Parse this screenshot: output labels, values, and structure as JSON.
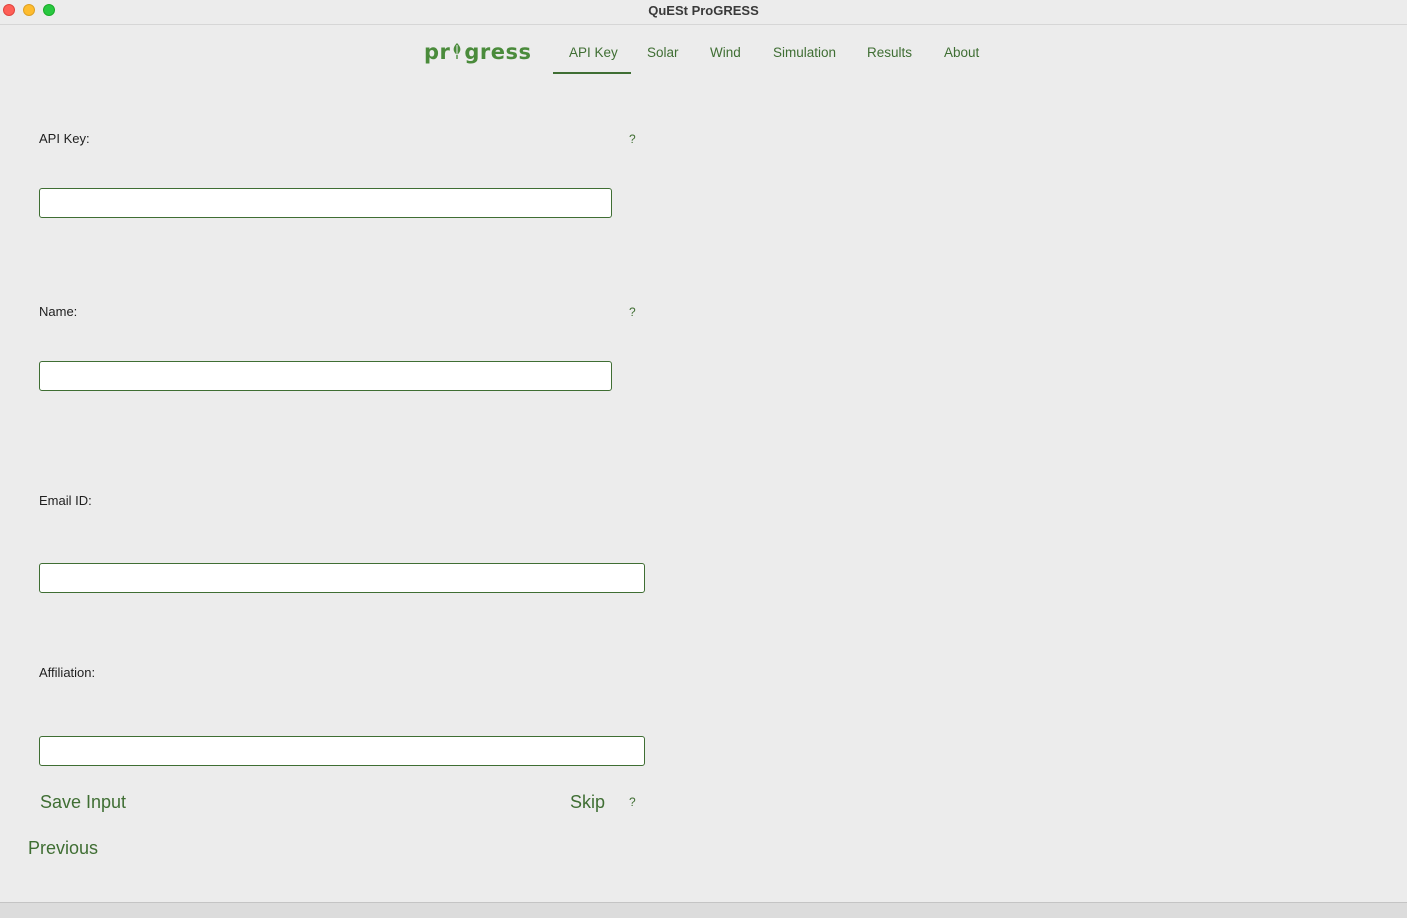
{
  "window": {
    "title": "QuESt ProGRESS"
  },
  "logo": {
    "text_before": "pr",
    "text_after": "gress",
    "color": "#4a8b3b"
  },
  "nav": {
    "active": "API Key",
    "tabs": [
      {
        "label": "API Key"
      },
      {
        "label": "Solar"
      },
      {
        "label": "Wind"
      },
      {
        "label": "Simulation"
      },
      {
        "label": "Results"
      },
      {
        "label": "About"
      }
    ]
  },
  "form": {
    "api_key": {
      "label": "API Key:",
      "value": "",
      "help": "?"
    },
    "name": {
      "label": "Name:",
      "value": "",
      "help": "?"
    },
    "email": {
      "label": "Email ID:",
      "value": ""
    },
    "affiliation": {
      "label": "Affiliation:",
      "value": ""
    }
  },
  "actions": {
    "save_label": "Save Input",
    "skip_label": "Skip",
    "help": "?",
    "previous_label": "Previous"
  },
  "colors": {
    "accent": "#3f6e33",
    "background": "#ececec"
  }
}
